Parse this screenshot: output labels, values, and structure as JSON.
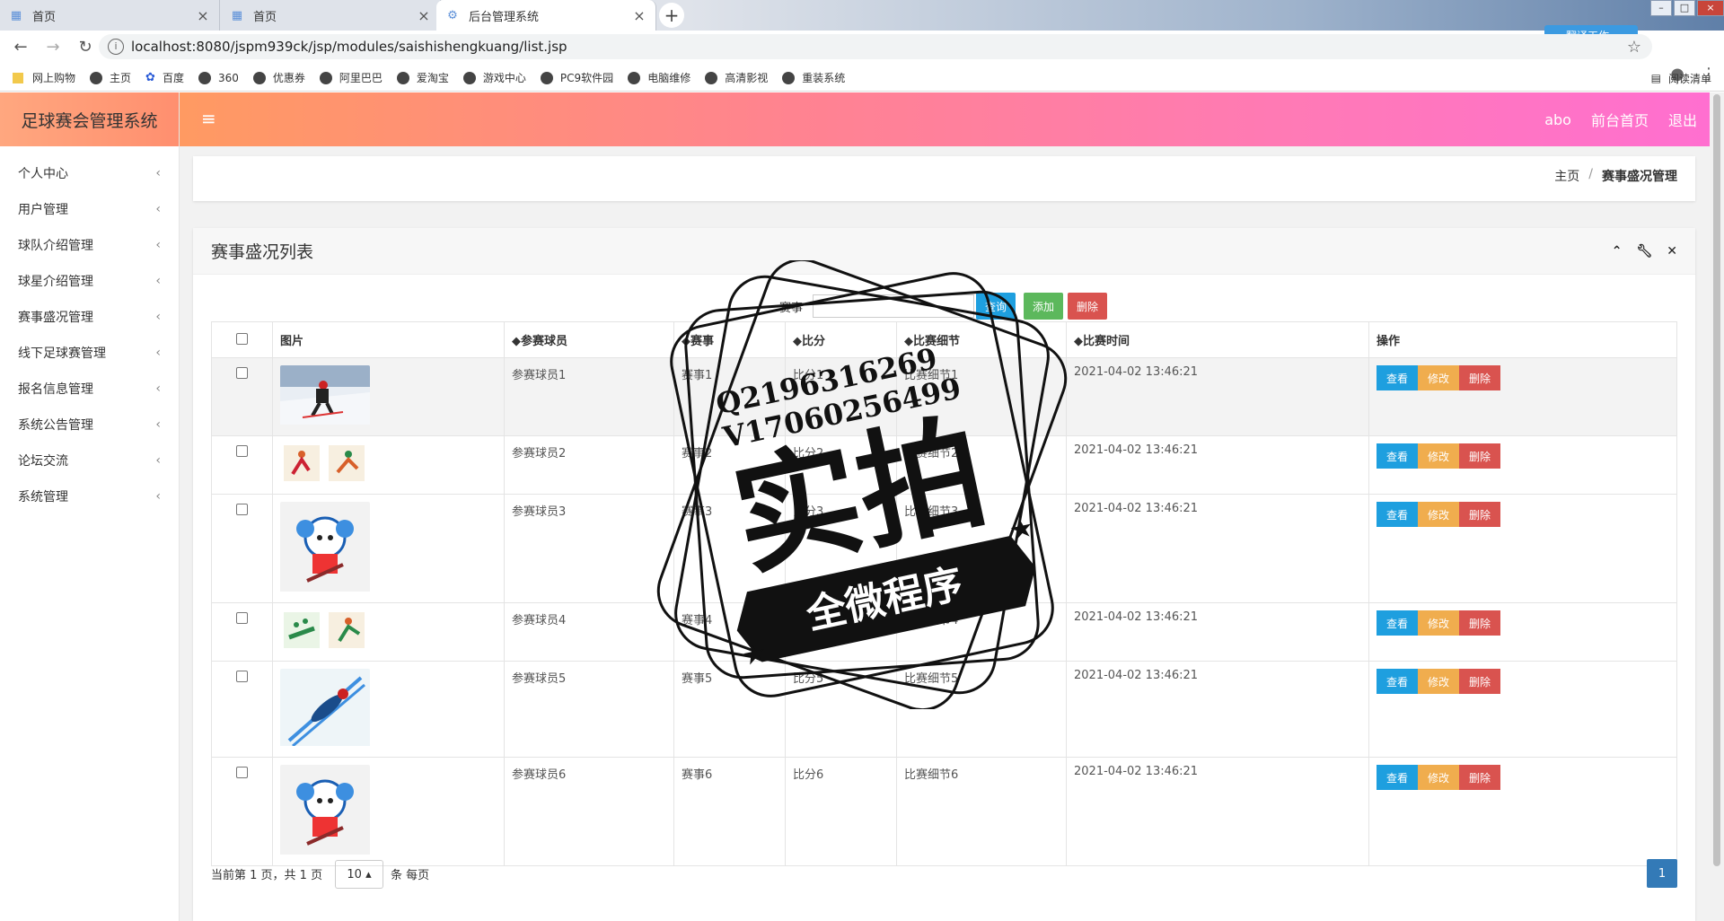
{
  "browser": {
    "tabs": [
      {
        "label": "首页",
        "icon": "page-icon"
      },
      {
        "label": "首页",
        "icon": "page-icon"
      },
      {
        "label": "后台管理系统",
        "icon": "gear-icon"
      }
    ],
    "url": "localhost:8080/jspm939ck/jsp/modules/saishishengkuang/list.jsp",
    "bookmarks": [
      "网上购物",
      "主页",
      "百度",
      "360",
      "优惠券",
      "阿里巴巴",
      "爱淘宝",
      "游戏中心",
      "PC9软件园",
      "电脑维修",
      "高清影视",
      "重装系统"
    ],
    "reading_list": "阅读清单",
    "extension_label": "翻译工作"
  },
  "app": {
    "brand": "足球赛会管理系统",
    "header": {
      "user": "abo",
      "home": "前台首页",
      "logout": "退出"
    },
    "sidebar": [
      "个人中心",
      "用户管理",
      "球队介绍管理",
      "球星介绍管理",
      "赛事盛况管理",
      "线下足球赛管理",
      "报名信息管理",
      "系统公告管理",
      "论坛交流",
      "系统管理"
    ],
    "breadcrumb": {
      "home": "主页",
      "sep": "/",
      "current": "赛事盛况管理"
    }
  },
  "list": {
    "title": "赛事盛况列表",
    "search": {
      "label": "赛事",
      "query_btn": "查询",
      "add_btn": "添加",
      "delete_btn": "删除"
    },
    "columns": [
      "图片",
      "◆参赛球员",
      "◆赛事",
      "◆比分",
      "◆比赛细节",
      "◆比赛时间",
      "操作"
    ],
    "row_actions": {
      "view": "查看",
      "edit": "修改",
      "delete": "删除"
    },
    "rows": [
      {
        "player": "参赛球员1",
        "event": "赛事1",
        "score": "比分1",
        "detail": "比赛细节1",
        "time": "2021-04-02 13:46:21",
        "image": "skier"
      },
      {
        "player": "参赛球员2",
        "event": "赛事2",
        "score": "比分2",
        "detail": "比赛细节2",
        "time": "2021-04-02 13:46:21",
        "image": "pictograms"
      },
      {
        "player": "参赛球员3",
        "event": "赛事3",
        "score": "比分3",
        "detail": "比赛细节3",
        "time": "2021-04-02 13:46:21",
        "image": "mascot"
      },
      {
        "player": "参赛球员4",
        "event": "赛事4",
        "score": "比分4",
        "detail": "比赛细节4",
        "time": "2021-04-02 13:46:21",
        "image": "pictograms"
      },
      {
        "player": "参赛球员5",
        "event": "赛事5",
        "score": "比分5",
        "detail": "比赛细节5",
        "time": "2021-04-02 13:46:21",
        "image": "ski-jump"
      },
      {
        "player": "参赛球员6",
        "event": "赛事6",
        "score": "比分6",
        "detail": "比赛细节6",
        "time": "2021-04-02 13:46:21",
        "image": "mascot"
      }
    ],
    "pagination": {
      "summary": "当前第 1 页，共 1 页",
      "page_size": "10 ▴",
      "unit": "条 每页",
      "current_page": "1"
    }
  },
  "watermark": {
    "line1": "Q2196316269",
    "line2": "V17060256499",
    "big": "实拍",
    "banner": "全微程序"
  },
  "colors": {
    "header_start": "#ff9a62",
    "header_end": "#ff6fd0",
    "btn_view": "#1e9fdf",
    "btn_edit": "#f0ad4e",
    "btn_delete": "#d9534f",
    "btn_add": "#5cb85c",
    "page_active": "#337ab7"
  }
}
